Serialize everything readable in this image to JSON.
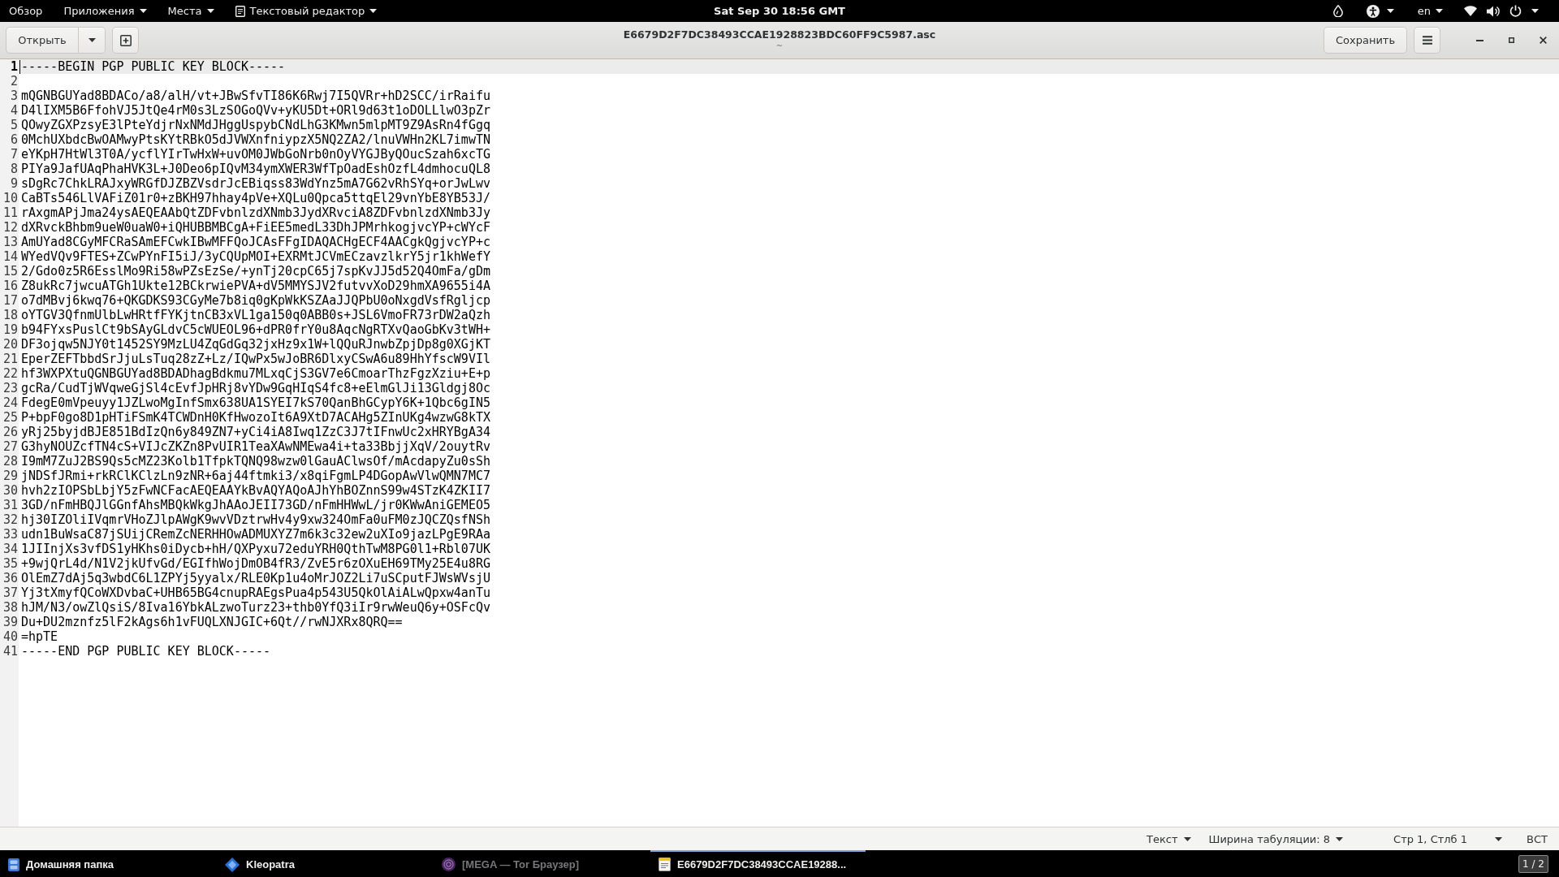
{
  "top_bar": {
    "activities": "Обзор",
    "menus": [
      {
        "label": "Приложения",
        "kind": "menu"
      },
      {
        "label": "Места",
        "kind": "menu"
      },
      {
        "label": "Текстовый редактор",
        "kind": "app-menu"
      }
    ],
    "clock": "Sat Sep 30  18:56 GMT",
    "language": "en"
  },
  "window": {
    "open_button": "Открыть",
    "title": "E6679D2F7DC38493CCAE1928823BDC60FF9C5987.asc",
    "subtitle": "~",
    "save_button": "Сохранить"
  },
  "editor": {
    "lines": [
      {
        "number": "1",
        "text": "-----BEGIN PGP PUBLIC KEY BLOCK-----",
        "current": true
      },
      {
        "number": "2",
        "current": false
      },
      {
        "number": "3",
        "text": "mQGNBGUYad8BDACo/a8/alH/vt+JBwSfvTI86K6Rwj7I5QVRr+hD2SCC/irRaifu",
        "current": false
      },
      {
        "number": "4",
        "text": "D4lIXM5B6FfohVJ5JtQe4rM0s3LzSOGoQVv+yKU5Dt+ORl9d63t1oDOLLlwO3pZr",
        "current": false
      },
      {
        "number": "5",
        "text": "QOwyZGXPzsyE3lPteYdjrNxNMdJHggUspybCNdLhG3KMwn5mlpMT9Z9AsRn4fGgq",
        "current": false
      },
      {
        "number": "6",
        "text": "0MchUXbdcBwOAMwyPtsKYtRBkO5dJVWXnfniypzX5NQ2ZA2/lnuVWHn2KL7imwTN",
        "current": false
      },
      {
        "number": "7",
        "text": "eYKpH7HtWl3T0A/ycflYIrTwHxW+uvOM0JWbGoNrb0nOyVYGJByQOucSzah6xcTG",
        "current": false
      },
      {
        "number": "8",
        "text": "PIYa9JafUAqPhaHVK3L+J0Deo6pIQvM34ymXWER3WfTpOadEshOzfL4dmhocuQL8",
        "current": false
      },
      {
        "number": "9",
        "text": "sDgRc7ChkLRAJxyWRGfDJZBZVsdrJcEBiqss83WdYnz5mA7G62vRhSYq+orJwLwv",
        "current": false
      },
      {
        "number": "10",
        "text": "CaBTs546LlVAFiZ01r0+zBKH97hhay4pVe+XQLu0Qpca5ttqEl29vnYbE8YB53J/",
        "current": false
      },
      {
        "number": "11",
        "text": "rAxgmAPjJma24ysAEQEAAbQtZDFvbnlzdXNmb3JydXRvciA8ZDFvbnlzdXNmb3Jy",
        "current": false
      },
      {
        "number": "12",
        "text": "dXRvckBhbm9ueW0uaW0+iQHUBBMBCgA+FiEE5medL33DhJPMrhkogjvcYP+cWYcF",
        "current": false
      },
      {
        "number": "13",
        "text": "AmUYad8CGyMFCRaSAmEFCwkIBwMFFQoJCAsFFgIDAQACHgECF4AACgkQgjvcYP+c",
        "current": false
      },
      {
        "number": "14",
        "text": "WYedVQv9FTES+ZCwPYnFI5iJ/3yCQUpMOI+EXRMtJCVmECzavzlkrY5jr1khWefY",
        "current": false
      },
      {
        "number": "15",
        "text": "2/Gdo0z5R6EsslMo9Ri58wPZsEzSe/+ynTj20cpC65j7spKvJJ5d52Q4OmFa/gDm",
        "current": false
      },
      {
        "number": "16",
        "text": "Z8ukRc7jwcuATGh1Ukte12BCkrwiePVA+dV5MMYSJV2futvvXoD29hmXA9655i4A",
        "current": false
      },
      {
        "number": "17",
        "text": "o7dMBvj6kwq76+QKGDKS93CGyMe7b8iq0gKpWkKSZAaJJQPbU0oNxgdVsfRgljcp",
        "current": false
      },
      {
        "number": "18",
        "text": "oYTGV3QfnmUlbLwHRtfFYKjtnCB3xVL1ga150q0ABB0s+JSL6VmoFR73rDW2aQzh",
        "current": false
      },
      {
        "number": "19",
        "text": "b94FYxsPuslCt9bSAyGLdvC5cWUEOL96+dPR0frY0u8AqcNgRTXvQaoGbKv3tWH+",
        "current": false
      },
      {
        "number": "20",
        "text": "DF3ojqw5NJY0t1452SY9MzLU4ZqGdGq32jxHz9x1W+lQQuRJnwbZpjDp8g0XGjKT",
        "current": false
      },
      {
        "number": "21",
        "text": "EperZEFTbbdSrJjuLsTuq28zZ+Lz/IQwPx5wJoBR6DlxyCSwA6u89HhYfscW9VIl",
        "current": false
      },
      {
        "number": "22",
        "text": "hf3WXPXtuQGNBGUYad8BDADhagBdkmu7MLxqCjS3GV7e6CmoarThzFgzXziu+E+p",
        "current": false
      },
      {
        "number": "23",
        "text": "gcRa/CudTjWVqweGjSl4cEvfJpHRj8vYDw9GqHIqS4fc8+eElmGlJi13Gldgj8Oc",
        "current": false
      },
      {
        "number": "24",
        "text": "FdegE0mVpeuyy1JZLwoMgInfSmx638UA1SYEI7kS70QanBhGCypY6K+1Qbc6gIN5",
        "current": false
      },
      {
        "number": "25",
        "text": "P+bpF0go8D1pHTiFSmK4TCWDnH0KfHwozoIt6A9XtD7ACAHg5ZInUKg4wzwG8kTX",
        "current": false
      },
      {
        "number": "26",
        "text": "yRj25byjdBJE851BdIzQn6y849ZN7+yCi4iA8Iwq1ZzC3J7tIFnwUc2xHRYBgA34",
        "current": false
      },
      {
        "number": "27",
        "text": "G3hyNOUZcfTN4cS+VIJcZKZn8PvUIR1TeaXAwNMEwa4i+ta33BbjjXqV/2ouytRv",
        "current": false
      },
      {
        "number": "28",
        "text": "I9mM7ZuJ2BS9Qs5cMZ23Kolb1TfpkTQNQ98wzw0lGauAClwsOf/mAcdapyZu0sSh",
        "current": false
      },
      {
        "number": "29",
        "text": "jNDSfJRmi+rkRClKClzLn9zNR+6aj44ftmki3/x8qiFgmLP4DGopAwVlwQMN7MC7",
        "current": false
      },
      {
        "number": "30",
        "text": "hvh2zIOPSbLbjY5zFwNCFacAEQEAAYkBvAQYAQoAJhYhBOZnnS99w4STzK4ZKII7",
        "current": false
      },
      {
        "number": "31",
        "text": "3GD/nFmHBQJlGGnfAhsMBQkWkgJhAAoJEII73GD/nFmHHWwL/jr0KWwAniGEMEO5",
        "current": false
      },
      {
        "number": "32",
        "text": "hj30IZOliIVqmrVHoZJlpAWgK9wvVDztrwHv4y9xw324OmFa0uFM0zJQCZQsfNSh",
        "current": false
      },
      {
        "number": "33",
        "text": "udn1BuWsaC87jSUijCRemZcNERHHOwADMUXYZ7m6k3c32ew2uXIo9jazLPgE9RAa",
        "current": false
      },
      {
        "number": "34",
        "text": "1JIInjXs3vfDS1yHKhs0iDycb+hH/QXPyxu72eduYRH0QthTwM8PG0l1+Rbl07UK",
        "current": false
      },
      {
        "number": "35",
        "text": "+9wjQrL4d/N1V2jkUfvGd/EGIfhWojDmOB4fR3/ZvE5r6zOXuEH69TMy25E4u8RG",
        "current": false
      },
      {
        "number": "36",
        "text": "OlEmZ7dAj5q3wbdC6L1ZPYj5yyalx/RLE0Kp1u4oMrJOZ2Li7uSCputFJWsWVsjU",
        "current": false
      },
      {
        "number": "37",
        "text": "Yj3tXmyfQCoWXDvbaC+UHB65BG4cnupRAEgsPua4p543U5QkOlAiALwQpxw4anTu",
        "current": false
      },
      {
        "number": "38",
        "text": "hJM/N3/owZlQsiS/8Iva16YbkALzwoTurz23+thb0YfQ3iIr9rwWeuQ6y+OSFcQv",
        "current": false
      },
      {
        "number": "39",
        "text": "Du+DU2mznfz5lF2kAgs6h1vFUQLXNJGIC+6Qt//rwNJXRx8QRQ==",
        "current": false
      },
      {
        "number": "40",
        "text": "=hpTE",
        "current": false
      },
      {
        "number": "41",
        "text": "-----END PGP PUBLIC KEY BLOCK-----",
        "current": false
      }
    ]
  },
  "status_bar": {
    "items": [
      {
        "label": "Текст",
        "kind": "dropdown"
      },
      {
        "label": "Ширина табуляции: 8",
        "kind": "dropdown"
      },
      {
        "label": "Стр 1, Стлб 1",
        "kind": "dropdown"
      },
      {
        "label": "ВСТ",
        "kind": "label"
      }
    ]
  },
  "taskbar": {
    "items": [
      {
        "label": "Домашняя папка",
        "kind": "files",
        "selected": false,
        "minimized": false
      },
      {
        "label": "Kleopatra",
        "kind": "keys",
        "selected": false,
        "minimized": false
      },
      {
        "label": "[MEGA — Tor Браузер]",
        "kind": "browser",
        "selected": false,
        "minimized": true
      },
      {
        "label": "E6679D2F7DC38493CCAE19288...",
        "kind": "editor",
        "selected": true,
        "minimized": false
      }
    ],
    "workspace": "1 / 2"
  }
}
